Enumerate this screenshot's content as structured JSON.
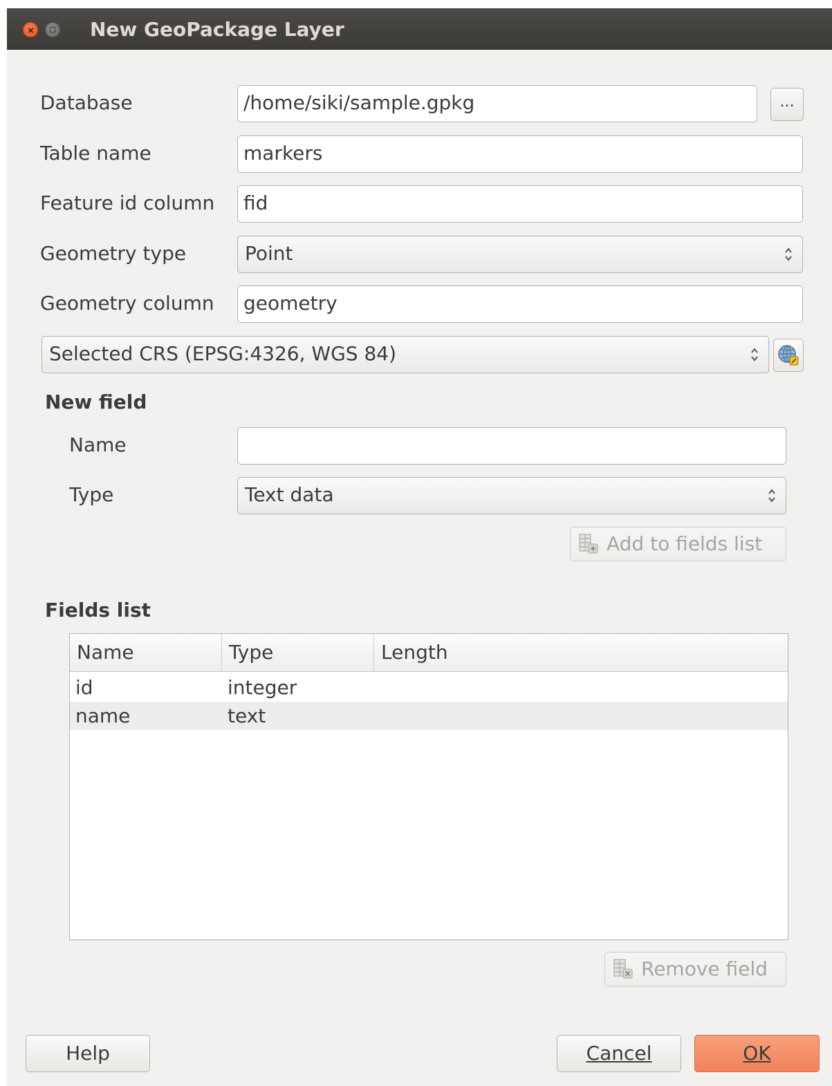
{
  "window": {
    "title": "New GeoPackage Layer"
  },
  "form": {
    "database_label": "Database",
    "database_value": "/home/siki/sample.gpkg",
    "browse_label": "...",
    "table_name_label": "Table name",
    "table_name_value": "markers",
    "fid_label": "Feature id column",
    "fid_value": "fid",
    "geometry_type_label": "Geometry type",
    "geometry_type_value": "Point",
    "geometry_column_label": "Geometry column",
    "geometry_column_value": "geometry",
    "crs_value": "Selected CRS (EPSG:4326, WGS 84)"
  },
  "new_field": {
    "heading": "New field",
    "name_label": "Name",
    "name_value": "",
    "type_label": "Type",
    "type_value": "Text data",
    "add_button": "Add to fields list"
  },
  "fields_list": {
    "heading": "Fields list",
    "columns": [
      "Name",
      "Type",
      "Length"
    ],
    "rows": [
      {
        "name": "id",
        "type": "integer",
        "length": ""
      },
      {
        "name": "name",
        "type": "text",
        "length": ""
      }
    ],
    "remove_button": "Remove field"
  },
  "buttons": {
    "help": "Help",
    "cancel": "Cancel",
    "ok": "OK"
  },
  "colors": {
    "ok_accent": "#f0845c",
    "titlebar": "#3b3a36",
    "close_button": "#e55326"
  }
}
